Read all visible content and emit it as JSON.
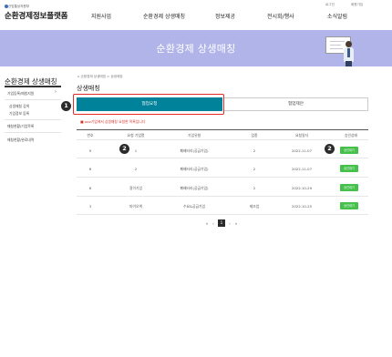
{
  "header": {
    "org_small": "산업통상자원부",
    "logo": "순환경제정보플랫폼",
    "util_links": [
      "로그인",
      "회원가입"
    ],
    "nav": [
      "지원사업",
      "순환경제 상생매칭",
      "정보제공",
      "전시회/행사",
      "소식알림"
    ]
  },
  "banner": {
    "title": "순환경제 상생매칭"
  },
  "sidebar": {
    "title": "순환경제 상생매칭",
    "items": [
      "기업등록/매칭지원",
      "상생매칭 검색",
      "기업정보 등록",
      "매칭현황/기업목록",
      "매칭현황/완료내역"
    ]
  },
  "breadcrumb": "순환경제 상생매칭 > 상생매칭",
  "content": {
    "title": "상생매칭",
    "tab_active": "협업요청",
    "tab_inactive": "협업제안",
    "notice": "■ ooo기업에서 상생매칭 요청한 목록입니다",
    "columns": [
      "번호",
      "요청 기업명",
      "기업유형",
      "업종",
      "요청일자",
      "승인상태"
    ],
    "rows": [
      {
        "no": "9",
        "company": "1",
        "type": "폐배터리(공급기업)",
        "industry": "2",
        "date": "2022-11-07",
        "status": "승인대기"
      },
      {
        "no": "8",
        "company": "2",
        "type": "폐배터리(공급기업)",
        "industry": "2",
        "date": "2022-11-07",
        "status": "승인대기"
      },
      {
        "no": "6",
        "company": "정이기업",
        "type": "폐배터리(공급기업)",
        "industry": "2",
        "date": "2022-10-29",
        "status": "승인대기"
      },
      {
        "no": "3",
        "company": "마이오엑",
        "type": "수요&공급기업",
        "industry": "제조업",
        "date": "2022-10-25",
        "status": "승인대기"
      }
    ]
  },
  "annotations": {
    "badge1": "1",
    "badge2a": "2",
    "badge2b": "2"
  },
  "pagination": {
    "first": "«",
    "prev": "‹",
    "current": "1",
    "next": "›",
    "last": "»"
  },
  "colors": {
    "tab_active": "#00829a",
    "banner": "#b0b4e8",
    "approve": "#45c04a",
    "callout": "#e32b2b",
    "notice": "#d9342b"
  }
}
